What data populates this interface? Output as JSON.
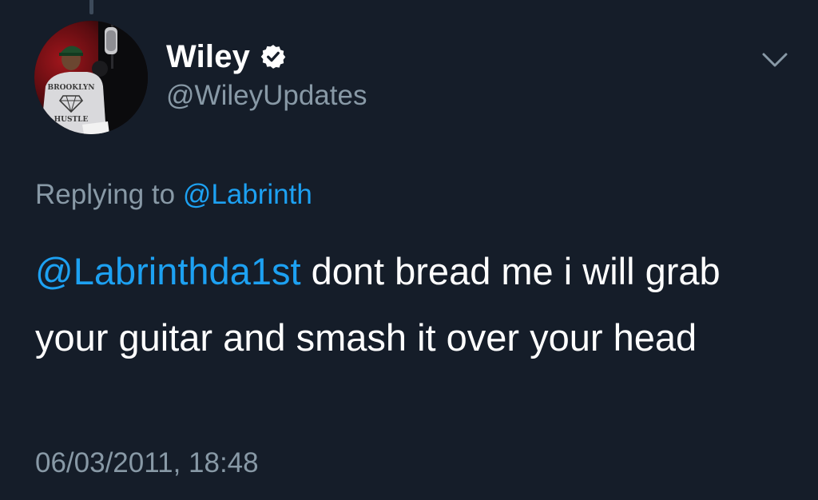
{
  "colors": {
    "background": "#151d29",
    "text_primary": "#ffffff",
    "text_secondary": "#8899a6",
    "link": "#1da1f2"
  },
  "author": {
    "display_name": "Wiley",
    "handle": "@WileyUpdates",
    "verified_icon": "verified-badge-icon",
    "avatar_text_top": "BROOKLYN",
    "avatar_text_bottom": "HUSTLE"
  },
  "menu": {
    "icon": "chevron-down-icon"
  },
  "reply": {
    "prefix": "Replying to ",
    "mention": "@Labrinth"
  },
  "tweet": {
    "mention": "@Labrinthda1st",
    "body": " dont bread me i will grab your guitar and smash it over your head"
  },
  "timestamp": "06/03/2011, 18:48"
}
